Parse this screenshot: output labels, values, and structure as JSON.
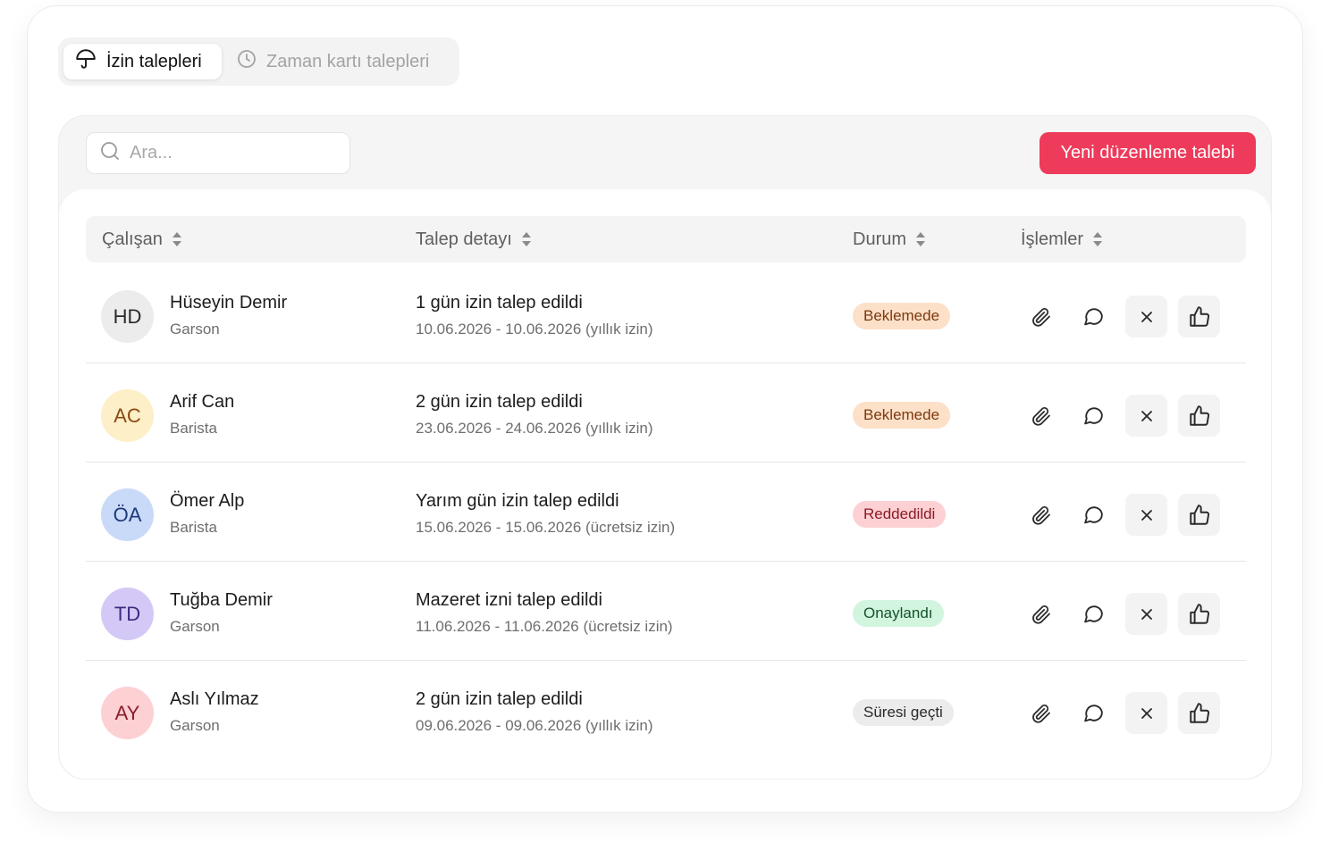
{
  "tabs": [
    {
      "label": "İzin talepleri",
      "icon": "umbrella-icon",
      "active": true
    },
    {
      "label": "Zaman kartı talepleri",
      "icon": "clock-icon",
      "active": false
    }
  ],
  "search": {
    "placeholder": "Ara..."
  },
  "new_request_button": "Yeni düzenleme talebi",
  "columns": [
    "Çalışan",
    "Talep detayı",
    "Durum",
    "İşlemler"
  ],
  "rows": [
    {
      "initials": "HD",
      "name": "Hüseyin Demir",
      "role": "Garson",
      "title": "1 gün izin talep edildi",
      "detail": "10.06.2026 - 10.06.2026 (yıllık izin)",
      "status": "Beklemede",
      "status_kind": "pending",
      "avatar_bg": "#ececec",
      "avatar_fg": "#2a2a2a"
    },
    {
      "initials": "AC",
      "name": "Arif Can",
      "role": "Barista",
      "title": "2 gün izin talep edildi",
      "detail": "23.06.2026 - 24.06.2026 (yıllık izin)",
      "status": "Beklemede",
      "status_kind": "pending",
      "avatar_bg": "#fdefc8",
      "avatar_fg": "#8a4a12"
    },
    {
      "initials": "ÖA",
      "name": "Ömer Alp",
      "role": "Barista",
      "title": "Yarım gün izin talep edildi",
      "detail": "15.06.2026 - 15.06.2026 (ücretsiz izin)",
      "status": "Reddedildi",
      "status_kind": "rejected",
      "avatar_bg": "#c9daf8",
      "avatar_fg": "#1f3a7a"
    },
    {
      "initials": "TD",
      "name": "Tuğba Demir",
      "role": "Garson",
      "title": "Mazeret izni talep edildi",
      "detail": "11.06.2026 - 11.06.2026 (ücretsiz izin)",
      "status": "Onaylandı",
      "status_kind": "approved",
      "avatar_bg": "#d4c9f6",
      "avatar_fg": "#3b2a80"
    },
    {
      "initials": "AY",
      "name": "Aslı Yılmaz",
      "role": "Garson",
      "title": "2 gün izin talep edildi",
      "detail": "09.06.2026 - 09.06.2026 (yıllık izin)",
      "status": "Süresi geçti",
      "status_kind": "expired",
      "avatar_bg": "#fdd0d4",
      "avatar_fg": "#8a1f2a"
    }
  ],
  "row_actions": [
    "paperclip-icon",
    "comment-icon",
    "close-icon",
    "thumbs-up-icon"
  ],
  "status_colors": {
    "pending": {
      "bg": "#fde0c8",
      "fg": "#7a3a10"
    },
    "rejected": {
      "bg": "#fdd0d4",
      "fg": "#8a1a26"
    },
    "approved": {
      "bg": "#d2f5df",
      "fg": "#14532d"
    },
    "expired": {
      "bg": "#ececec",
      "fg": "#2a2a2a"
    }
  },
  "accent": "#ee3b5b"
}
